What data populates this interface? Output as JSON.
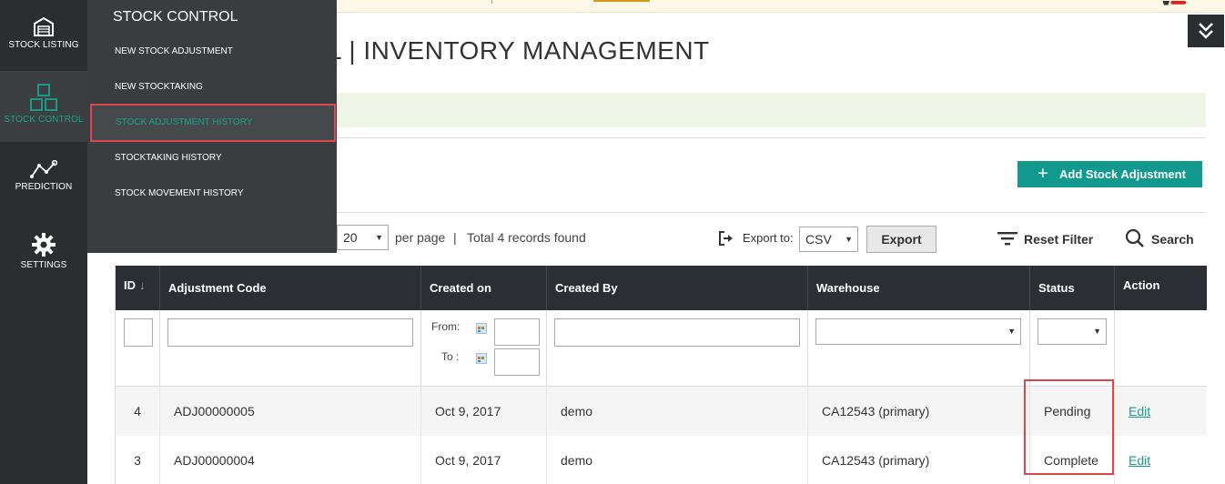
{
  "sidebar": {
    "items": [
      {
        "label": "STOCK LISTING",
        "icon": "warehouse-icon"
      },
      {
        "label": "STOCK CONTROL",
        "icon": "boxes-icon",
        "active": true
      },
      {
        "label": "PREDICTION",
        "icon": "line-chart-icon"
      },
      {
        "label": "SETTINGS",
        "icon": "gear-icon"
      }
    ]
  },
  "flyout": {
    "title": "STOCK CONTROL",
    "items": [
      {
        "label": "NEW STOCK ADJUSTMENT"
      },
      {
        "label": "NEW STOCKTAKING"
      },
      {
        "label": "STOCK ADJUSTMENT HISTORY",
        "selected": true
      },
      {
        "label": "STOCKTAKING HISTORY"
      },
      {
        "label": "STOCK MOVEMENT HISTORY"
      }
    ]
  },
  "header": {
    "title": "L | INVENTORY MANAGEMENT"
  },
  "actions": {
    "add_label": "Add Stock Adjustment"
  },
  "toolbar": {
    "per_page_value": "20",
    "per_page_label": "per page",
    "separator": "|",
    "total_records": "Total 4 records found",
    "export_label": "Export to:",
    "export_format": "CSV",
    "export_button": "Export",
    "reset_filter": "Reset Filter",
    "search": "Search"
  },
  "grid": {
    "columns": [
      "ID",
      "Adjustment Code",
      "Created on",
      "Created By",
      "Warehouse",
      "Status",
      "Action"
    ],
    "sort_indicator": "↓",
    "filters": {
      "from_label": "From:",
      "to_label": "To :"
    },
    "rows": [
      {
        "id": "4",
        "code": "ADJ00000005",
        "created_on": "Oct 9, 2017",
        "created_by": "demo",
        "warehouse": "CA12543 (primary)",
        "status": "Pending",
        "action": "Edit"
      },
      {
        "id": "3",
        "code": "ADJ00000004",
        "created_on": "Oct 9, 2017",
        "created_by": "demo",
        "warehouse": "CA12543 (primary)",
        "status": "Complete",
        "action": "Edit"
      }
    ]
  },
  "colors": {
    "accent": "#11998e",
    "sidebar_bg": "#2b2e30",
    "highlight": "#e0474c"
  }
}
